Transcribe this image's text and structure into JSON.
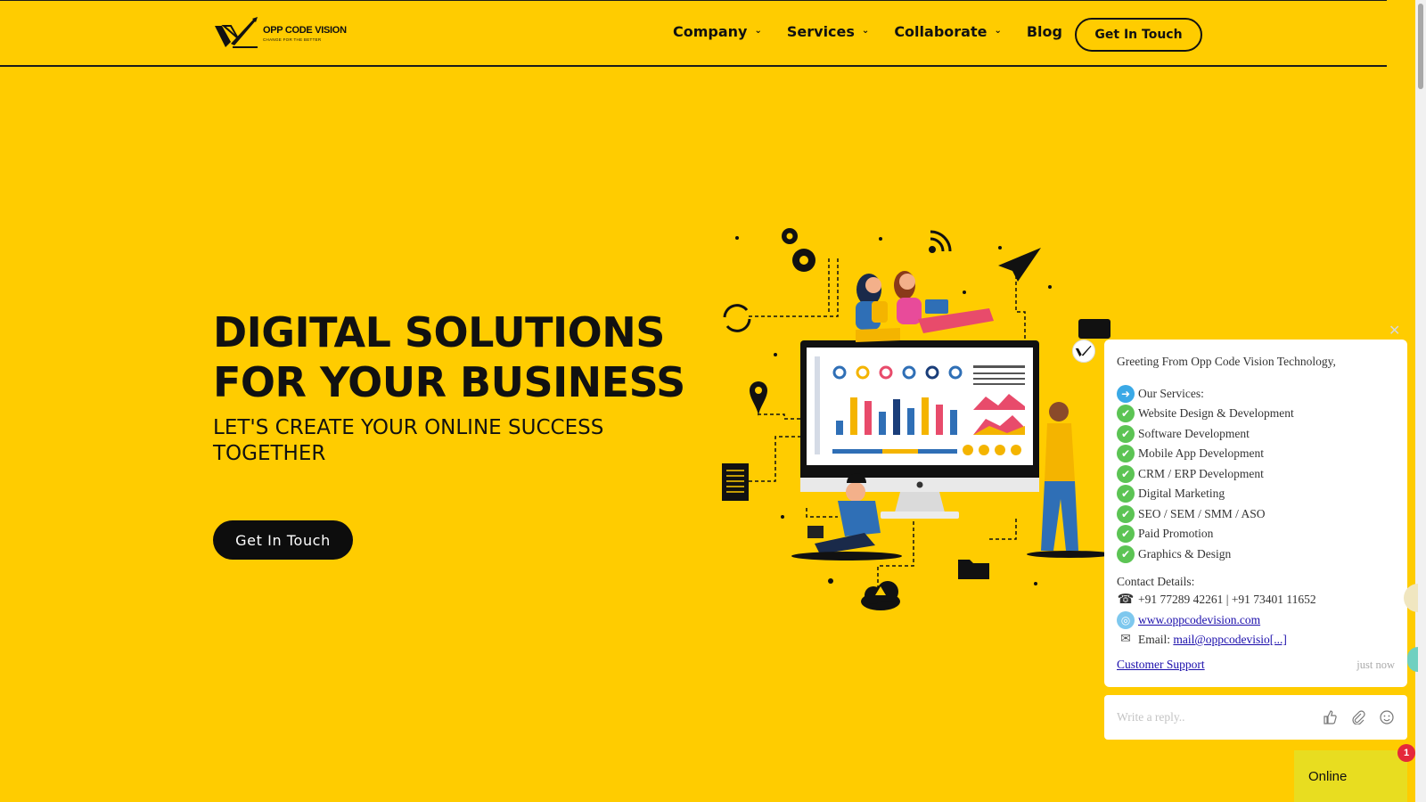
{
  "brand": {
    "name": "OPP CODE VISION",
    "tagline": "CHANGE FOR THE BETTER"
  },
  "nav": {
    "items": [
      {
        "label": "Company",
        "has_dropdown": true
      },
      {
        "label": "Services",
        "has_dropdown": true
      },
      {
        "label": "Collaborate",
        "has_dropdown": true
      },
      {
        "label": "Blog",
        "has_dropdown": false
      }
    ],
    "cta_label": "Get In Touch"
  },
  "hero": {
    "title_line1": "DIGITAL SOLUTIONS",
    "title_line2": "FOR YOUR BUSINESS",
    "subtitle": "LET'S CREATE YOUR ONLINE SUCCESS TOGETHER",
    "cta_label": "Get In Touch"
  },
  "chat": {
    "greeting": "Greeting From Opp Code Vision Technology,",
    "services_heading": "Our Services:",
    "services": [
      "Website Design & Development",
      "Software Development",
      "Mobile App Development",
      "CRM / ERP Development",
      "Digital Marketing",
      "SEO / SEM / SMM / ASO",
      "Paid Promotion",
      "Graphics & Design"
    ],
    "contact_heading": "Contact Details:",
    "phones": "+91 77289 42261 | +91 73401 11652",
    "website": "www.oppcodevision.com",
    "email_label": "Email:",
    "email": "mail@oppcodevisio[...]",
    "support_link": "Customer Support",
    "timestamp": "just now",
    "reply_placeholder": "Write a reply..",
    "status": "Online",
    "unread_count": "1"
  },
  "colors": {
    "background": "#FFCC00",
    "dark": "#111111",
    "check": "#5cc454",
    "badge": "#e5283a",
    "online": "#e8dd20"
  },
  "icons": {
    "nav_chevron": "chevron-down-icon",
    "reply_like": "thumbs-up-icon",
    "reply_attach": "paperclip-icon",
    "reply_emoji": "smiley-icon"
  }
}
